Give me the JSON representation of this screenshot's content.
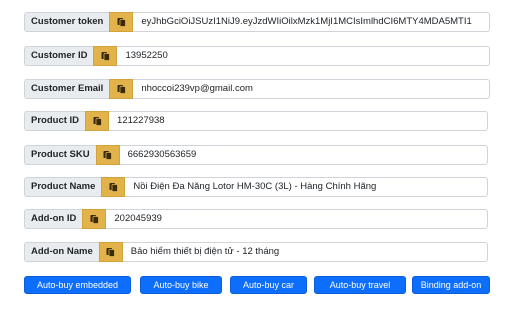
{
  "fields": [
    {
      "label": "Customer token",
      "value": "eyJhbGciOiJSUzI1NiJ9.eyJzdWIiOilxMzk1MjI1MCIsImlhdCI6MTY4MDA5MTI1"
    },
    {
      "label": "Customer ID",
      "value": "13952250"
    },
    {
      "label": "Customer Email",
      "value": "nhoccoi239vp@gmail.com"
    },
    {
      "label": "Product ID",
      "value": "121227938"
    },
    {
      "label": "Product SKU",
      "value": "6662930563659"
    },
    {
      "label": "Product Name",
      "value": "Nồi Điện Đa Năng Lotor HM-30C (3L) - Hàng Chính Hãng"
    },
    {
      "label": "Add-on ID",
      "value": "202045939"
    },
    {
      "label": "Add-on Name",
      "value": "Bảo hiểm thiết bị điện tử - 12 tháng"
    }
  ],
  "buttons": [
    {
      "label": "Auto-buy embedded"
    },
    {
      "label": "Auto-buy bike"
    },
    {
      "label": "Auto-buy car"
    },
    {
      "label": "Auto-buy travel"
    },
    {
      "label": "Binding add-on"
    }
  ],
  "icons": {
    "copy": "clipboard-icon"
  },
  "colors": {
    "copy_button": "#e2b34b",
    "label_bg": "#e9ecef",
    "primary": "#0d6efd"
  }
}
